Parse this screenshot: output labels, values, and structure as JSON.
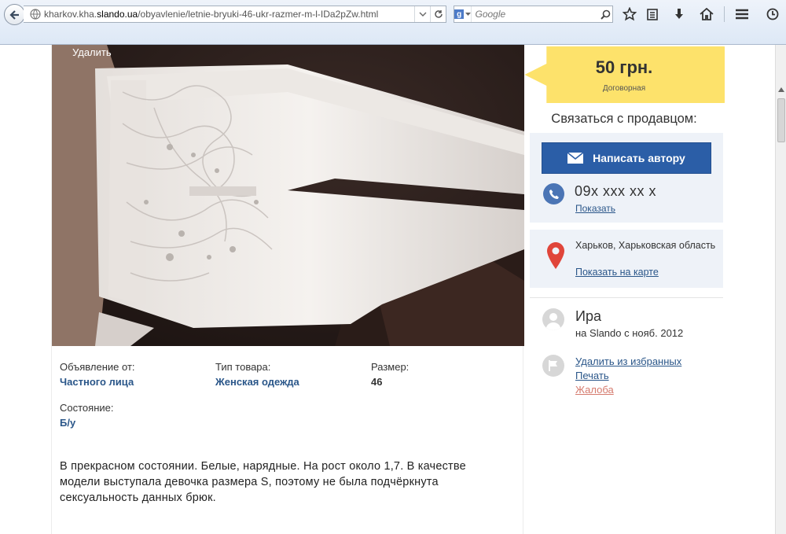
{
  "browser": {
    "url_prefix": "kharkov.kha.",
    "url_domain": "slando.ua",
    "url_path": "/obyavlenie/letnie-bryuki-46-ukr-razmer-m-l-IDa2pZw.html",
    "search_placeholder": "Google"
  },
  "photo": {
    "delete_label": "Удалить"
  },
  "params": [
    {
      "label": "Объявление от:",
      "value": "Частного лица"
    },
    {
      "label": "Тип товара:",
      "value": "Женская одежда"
    },
    {
      "label": "Размер:",
      "value": "46"
    },
    {
      "label": "Состояние:",
      "value": "Б/у"
    }
  ],
  "description": "В прекрасном состоянии. Белые, нарядные. На рост около 1,7. В качестве модели выступала девочка размера S, поэтому не была подчёркнута сексуальность данных брюк.",
  "sidebar": {
    "price": "50 грн.",
    "negotiable": "Договорная",
    "contact_title": "Связаться с продавцом:",
    "write_button": "Написать автору",
    "phone": "09x xxx xx x",
    "show_phone": "Показать",
    "location": "Харьков, Харьковская область",
    "show_on_map": "Показать на карте",
    "user_name": "Ира",
    "user_since": "на Slando с нояб. 2012",
    "remove_favorites": "Удалить из избранных",
    "print": "Печать",
    "report": "Жалоба"
  },
  "colors": {
    "price_bg": "#fde26b",
    "button_blue": "#2b5ea7",
    "link_blue": "#2a5689",
    "panel_bg": "#eef2f8",
    "report_red": "#d57a6d"
  },
  "icons": [
    "back-arrow-icon",
    "globe-icon",
    "dropdown-icon",
    "reload-icon",
    "google-icon",
    "search-icon",
    "bookmark-star-icon",
    "reading-list-icon",
    "download-icon",
    "home-icon",
    "menu-icon",
    "history-icon",
    "envelope-icon",
    "phone-icon",
    "map-pin-icon",
    "user-icon",
    "flag-icon"
  ]
}
